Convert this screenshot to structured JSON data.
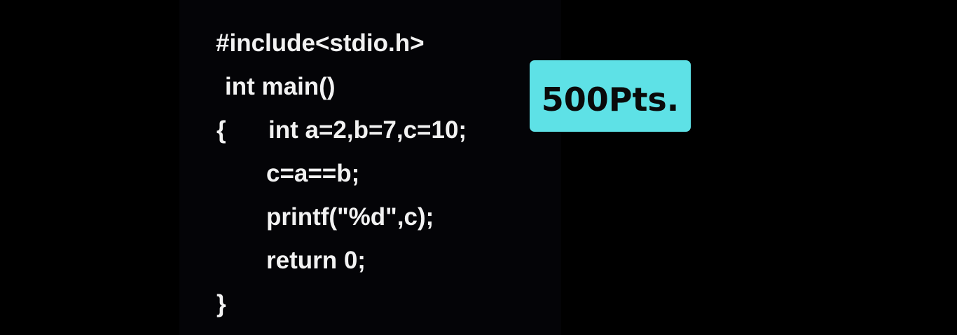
{
  "code": {
    "lines": [
      "#include<stdio.h>",
      "int main()",
      "{",
      "int a=2,b=7,c=10;",
      "c=a==b;",
      "printf(\"%d\",c);",
      "return 0;",
      "}"
    ]
  },
  "badge": {
    "label": "500Pts.",
    "background_color": "#5ee1e6",
    "text_color": "#0a0a0a"
  },
  "colors": {
    "page_background": "#000000",
    "code_panel_background": "#040407",
    "code_text": "#f2f2f2"
  }
}
